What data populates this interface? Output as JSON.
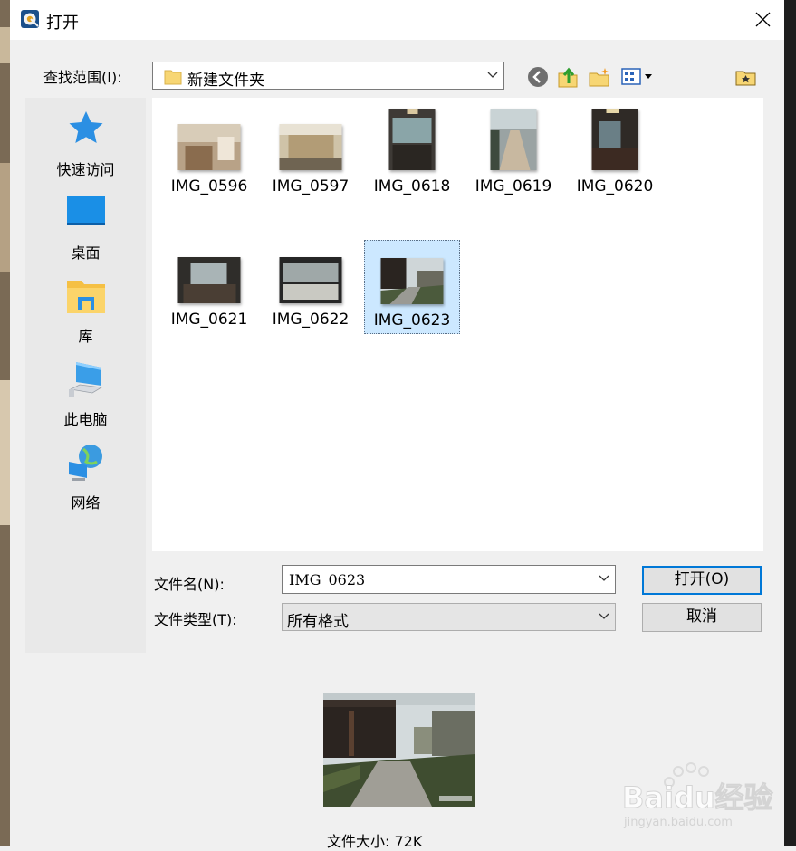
{
  "dialog": {
    "title": "打开",
    "look_in_label": "查找范围(I):",
    "look_in_value": "新建文件夹",
    "file_name_label": "文件名(N):",
    "file_name_value": "IMG_0623",
    "file_type_label": "文件类型(T):",
    "file_type_value": "所有格式",
    "open_button": "打开(O)",
    "cancel_button": "取消",
    "file_size_label": "文件大小: 72K"
  },
  "places": [
    {
      "label": "快速访问",
      "icon": "star-icon"
    },
    {
      "label": "桌面",
      "icon": "desktop-icon"
    },
    {
      "label": "库",
      "icon": "library-icon"
    },
    {
      "label": "此电脑",
      "icon": "computer-icon"
    },
    {
      "label": "网络",
      "icon": "network-icon"
    }
  ],
  "files": [
    {
      "name": "IMG_0596",
      "selected": false
    },
    {
      "name": "IMG_0597",
      "selected": false
    },
    {
      "name": "IMG_0618",
      "selected": false
    },
    {
      "name": "IMG_0619",
      "selected": false
    },
    {
      "name": "IMG_0620",
      "selected": false
    },
    {
      "name": "IMG_0621",
      "selected": false
    },
    {
      "name": "IMG_0622",
      "selected": false
    },
    {
      "name": "IMG_0623",
      "selected": true
    }
  ],
  "watermark": {
    "brand": "Baidu经验",
    "url": "jingyan.baidu.com"
  },
  "colors": {
    "selection": "#cce8ff",
    "accent": "#0078d7",
    "folder": "#f7d674"
  }
}
